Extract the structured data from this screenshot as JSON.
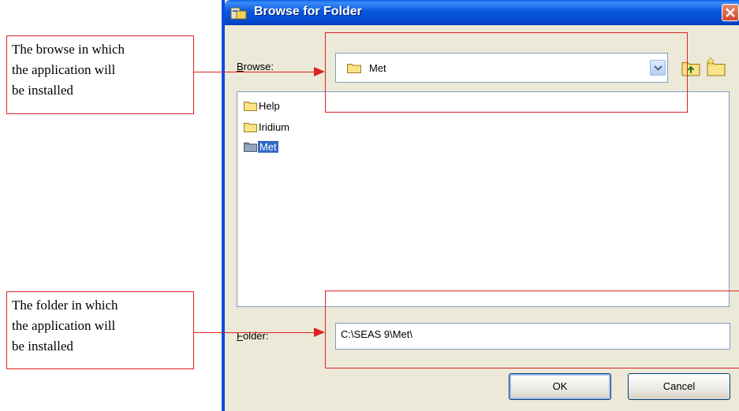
{
  "annotations": {
    "browse_note": "The browse in which\nthe application will\nbe installed",
    "folder_note": "The folder in which\nthe application will\nbe installed",
    "accent_color": "#dd2222"
  },
  "dialog": {
    "title": "Browse for Folder",
    "browse_label_key": "B",
    "browse_label_rest": "rowse:",
    "browse_value": "Met",
    "tree_items": [
      "Help",
      "Iridium",
      "Met"
    ],
    "selected_item": "Met",
    "folder_label_key": "F",
    "folder_label_rest": "older:",
    "folder_value": "C:\\SEAS 9\\Met\\",
    "ok_label": "OK",
    "cancel_label": "Cancel",
    "icons": [
      "app-icon",
      "close-icon",
      "dropdown-arrow-icon",
      "up-folder-icon",
      "new-folder-icon",
      "folder-icon"
    ]
  }
}
